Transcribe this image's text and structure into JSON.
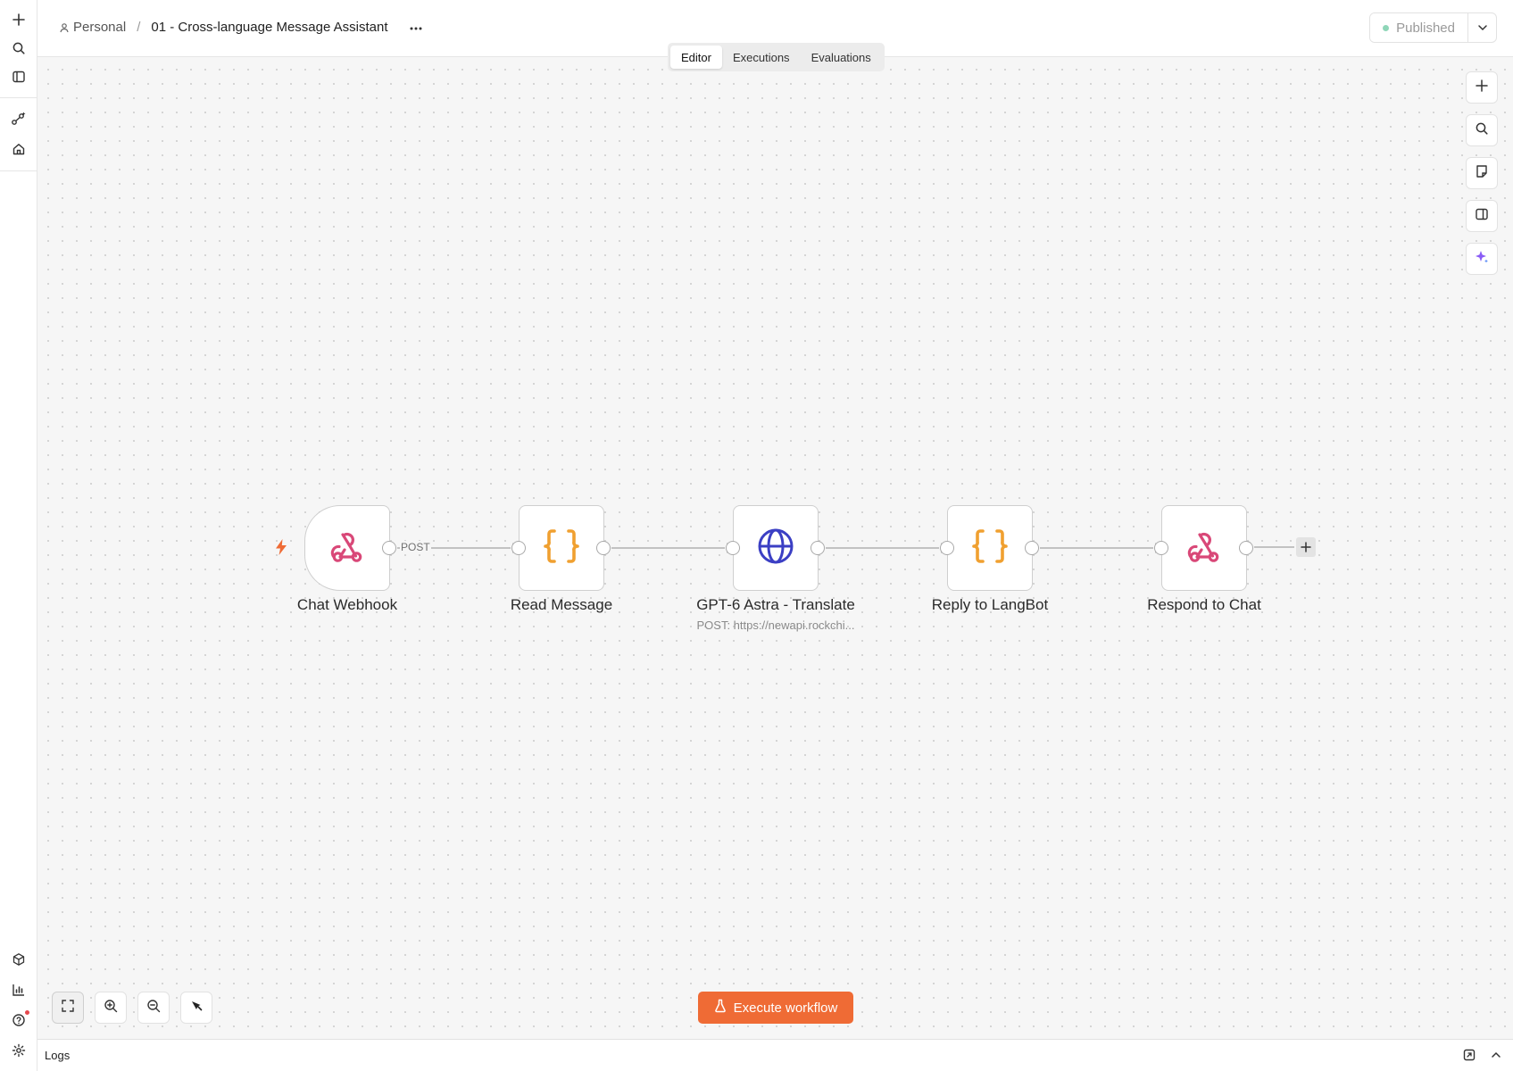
{
  "header": {
    "project": "Personal",
    "separator": "/",
    "workflow_title": "01 - Cross-language Message Assistant",
    "status_label": "Published"
  },
  "tabs": [
    {
      "label": "Editor",
      "active": true
    },
    {
      "label": "Executions",
      "active": false
    },
    {
      "label": "Evaluations",
      "active": false
    }
  ],
  "nodes": [
    {
      "label": "Chat Webhook",
      "icon": "webhook-icon",
      "type": "trigger"
    },
    {
      "label": "Read Message",
      "icon": "code-braces-icon"
    },
    {
      "label": "GPT-6 Astra - Translate",
      "subtitle": "POST: https://newapi.rockchi...",
      "icon": "globe-icon"
    },
    {
      "label": "Reply to LangBot",
      "icon": "code-braces-icon"
    },
    {
      "label": "Respond to Chat",
      "icon": "webhook-icon"
    }
  ],
  "edges": {
    "first_label": "POST"
  },
  "execute": {
    "label": "Execute workflow"
  },
  "logs": {
    "label": "Logs"
  },
  "colors": {
    "accent": "#ef6b35",
    "webhook": "#d94878",
    "code": "#f0a030",
    "globe": "#3b3fc4",
    "ai": "#8a5cf6",
    "published_dot": "#8fd6b8"
  }
}
